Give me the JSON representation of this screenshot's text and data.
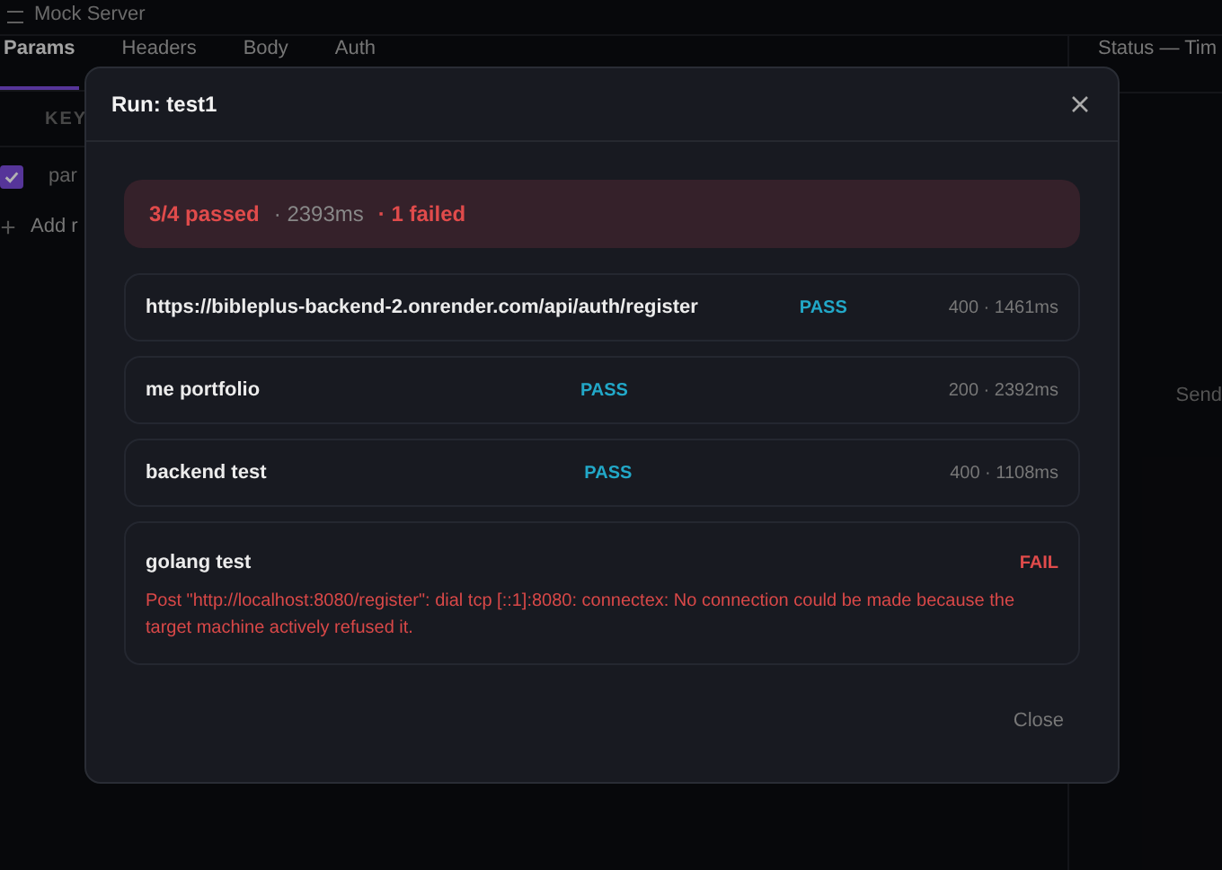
{
  "app": {
    "top_bar": {
      "label": "Mock Server"
    },
    "tabs": [
      {
        "label": "Params",
        "selected": true
      },
      {
        "label": "Headers",
        "selected": false
      },
      {
        "label": "Body",
        "selected": false
      },
      {
        "label": "Auth",
        "selected": false
      }
    ],
    "column_header": "KEY",
    "param_row": {
      "checked": true,
      "name": "par"
    },
    "add_row": "Add r",
    "status_header": "Status — Tim",
    "send": "Send"
  },
  "dialog": {
    "title": "Run: test1",
    "summary": {
      "passed": "3/4 passed",
      "duration": "· 2393ms",
      "failed": "· 1 failed"
    },
    "results": [
      {
        "name": "https://bibleplus-backend-2.onrender.com/api/auth/register",
        "status": "PASS",
        "passed": true,
        "meta": "400 · 1461ms"
      },
      {
        "name": "me portfolio",
        "status": "PASS",
        "passed": true,
        "meta": "200 · 2392ms"
      },
      {
        "name": "backend test",
        "status": "PASS",
        "passed": true,
        "meta": "400 · 1108ms"
      },
      {
        "name": "golang test",
        "status": "FAIL",
        "passed": false,
        "error": "Post \"http://localhost:8080/register\": dial tcp [::1]:8080: connectex: No connection could be made because the target machine actively refused it."
      }
    ],
    "close": "Close"
  }
}
